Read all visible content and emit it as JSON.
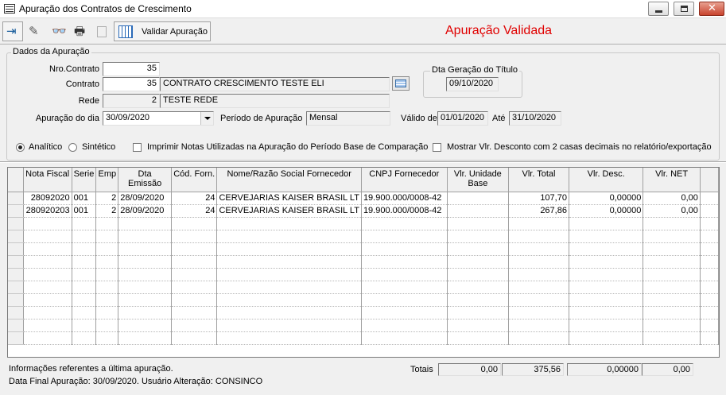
{
  "window": {
    "title": "Apuração dos Contratos de Crescimento",
    "close_glyph": "✕"
  },
  "toolbar": {
    "icons": [
      "exit-icon",
      "eraser-icon",
      "binoculars-icon",
      "printer-icon",
      "disabled-doc-icon",
      "calendar-icon"
    ],
    "glyphs": {
      "exit": "⇥",
      "eraser": "✎",
      "find": "👓",
      "print": "🖶"
    },
    "validar_label": "Validar Apuração",
    "status": "Apuração Validada",
    "status_color": "#e00000"
  },
  "dados": {
    "legend": "Dados da Apuração",
    "nro_contrato_label": "Nro.Contrato",
    "nro_contrato_value": "35",
    "contrato_label": "Contrato",
    "contrato_code": "35",
    "contrato_desc": "CONTRATO CRESCIMENTO TESTE ELI",
    "rede_label": "Rede",
    "rede_code": "2",
    "rede_desc": "TESTE REDE",
    "apuracao_dia_label": "Apuração do dia",
    "apuracao_dia_value": "30/09/2020",
    "periodo_label": "Período de Apuração",
    "periodo_value": "Mensal",
    "valido_label": "Válido de",
    "valido_de": "01/01/2020",
    "ate_label": "Até",
    "valido_ate": "31/10/2020",
    "dta_geracao_legend": "Dta Geração do Título",
    "dta_geracao_value": "09/10/2020"
  },
  "options": {
    "analitico": "Analítico",
    "sintetico": "Sintético",
    "selected": "Analítico",
    "imprimir_notas": "Imprimir Notas Utilizadas na Apuração do Período Base de Comparação",
    "mostrar_vlr": "Mostrar Vlr. Desconto com 2 casas decimais no relatório/exportação"
  },
  "grid": {
    "columns": [
      "Nota Fiscal",
      "Serie",
      "Emp",
      "Dta Emissão",
      "Cód. Forn.",
      "Nome/Razão Social Fornecedor",
      "CNPJ Fornecedor",
      "Vlr. Unidade Base",
      "Vlr. Total",
      "Vlr. Desc.",
      "Vlr. NET"
    ],
    "rows": [
      [
        "28092020",
        "001",
        "2",
        "28/09/2020",
        "24",
        "CERVEJARIAS KAISER BRASIL LT",
        "19.900.000/0008-42",
        "",
        "107,70",
        "0,00000",
        "0,00"
      ],
      [
        "280920203",
        "001",
        "2",
        "28/09/2020",
        "24",
        "CERVEJARIAS KAISER BRASIL LT",
        "19.900.000/0008-42",
        "",
        "267,86",
        "0,00000",
        "0,00"
      ]
    ]
  },
  "footer": {
    "info_line1": "Informações referentes a última apuração.",
    "info_line2": "Data Final Apuração: 30/09/2020. Usuário Alteração: CONSINCO",
    "totals_label": "Totais",
    "totals": [
      "0,00",
      "375,56",
      "0,00000",
      "0,00"
    ]
  }
}
